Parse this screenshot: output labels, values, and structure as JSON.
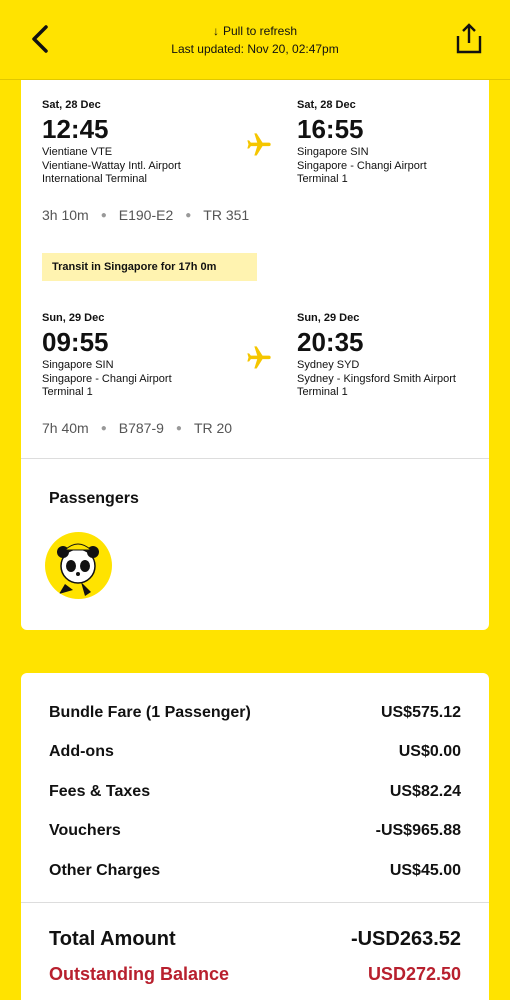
{
  "header": {
    "refresh_label": "Pull to refresh",
    "last_updated": "Last updated: Nov 20, 02:47pm"
  },
  "flights": [
    {
      "dep": {
        "date": "Sat, 28 Dec",
        "time": "12:45",
        "city": "Vientiane VTE",
        "airport": "Vientiane-Wattay Intl. Airport",
        "terminal": "International Terminal"
      },
      "arr": {
        "date": "Sat, 28 Dec",
        "time": "16:55",
        "city": "Singapore SIN",
        "airport": "Singapore - Changi Airport",
        "terminal": "Terminal 1"
      },
      "duration": "3h 10m",
      "aircraft": "E190-E2",
      "flight_no": "TR 351"
    },
    {
      "dep": {
        "date": "Sun, 29 Dec",
        "time": "09:55",
        "city": "Singapore SIN",
        "airport": "Singapore - Changi Airport",
        "terminal": "Terminal 1"
      },
      "arr": {
        "date": "Sun, 29 Dec",
        "time": "20:35",
        "city": "Sydney SYD",
        "airport": "Sydney - Kingsford Smith Airport",
        "terminal": "Terminal 1"
      },
      "duration": "7h 40m",
      "aircraft": "B787-9",
      "flight_no": "TR 20"
    }
  ],
  "transit": "Transit in Singapore for 17h 0m",
  "passengers_title": "Passengers",
  "fare": {
    "bundle_label": "Bundle Fare (1 Passenger)",
    "bundle_value": "US$575.12",
    "addons_label": "Add-ons",
    "addons_value": "US$0.00",
    "fees_label": "Fees & Taxes",
    "fees_value": "US$82.24",
    "vouchers_label": "Vouchers",
    "vouchers_value": "-US$965.88",
    "other_label": "Other Charges",
    "other_value": "US$45.00",
    "total_label": "Total Amount",
    "total_value": "-USD263.52",
    "outstanding_label": "Outstanding Balance",
    "outstanding_value": "USD272.50"
  },
  "colors": {
    "brand_yellow": "#FFE300",
    "outstanding_red": "#B8202E",
    "transit_bg": "#FFF3B0"
  },
  "icons": [
    "back-arrow-icon",
    "share-icon",
    "plane-icon",
    "passenger-avatar"
  ]
}
